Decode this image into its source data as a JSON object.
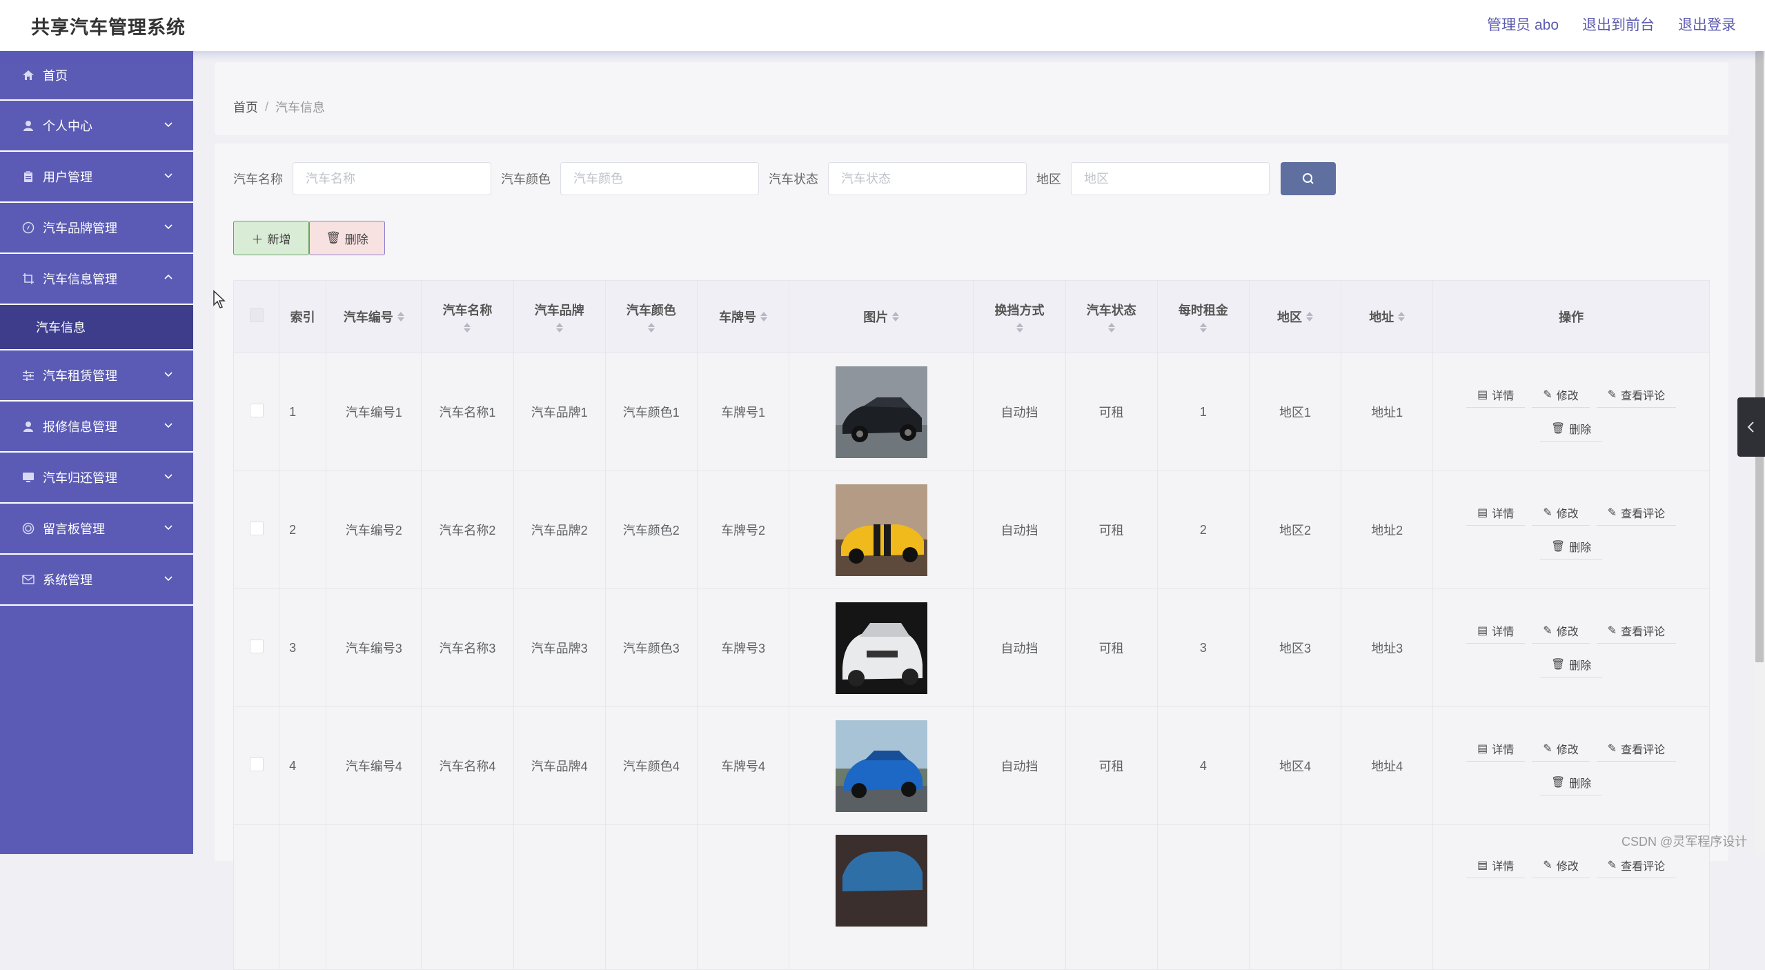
{
  "header": {
    "title": "共享汽车管理系统",
    "links": [
      "管理员 abo",
      "退出到前台",
      "退出登录"
    ]
  },
  "sidebar": {
    "items": [
      {
        "label": "首页",
        "icon": "home-icon"
      },
      {
        "label": "个人中心",
        "icon": "user-icon"
      },
      {
        "label": "用户管理",
        "icon": "clipboard-icon"
      },
      {
        "label": "汽车品牌管理",
        "icon": "compass-icon"
      },
      {
        "label": "汽车信息管理",
        "icon": "crop-icon"
      },
      {
        "label": "汽车租赁管理",
        "icon": "sliders-icon"
      },
      {
        "label": "报修信息管理",
        "icon": "user-icon"
      },
      {
        "label": "汽车归还管理",
        "icon": "monitor-icon"
      },
      {
        "label": "留言板管理",
        "icon": "target-icon"
      },
      {
        "label": "系统管理",
        "icon": "mail-icon"
      }
    ],
    "submenu": {
      "label": "汽车信息"
    }
  },
  "breadcrumb": {
    "home": "首页",
    "separator": "/",
    "current": "汽车信息"
  },
  "search": {
    "fields": [
      {
        "label": "汽车名称",
        "placeholder": "汽车名称"
      },
      {
        "label": "汽车颜色",
        "placeholder": "汽车颜色"
      },
      {
        "label": "汽车状态",
        "placeholder": "汽车状态"
      },
      {
        "label": "地区",
        "placeholder": "地区"
      }
    ]
  },
  "actions": {
    "add": "新增",
    "delete": "删除"
  },
  "table": {
    "headers": {
      "index": "索引",
      "car_no": "汽车编号",
      "car_name": "汽车名称",
      "brand": "汽车品牌",
      "color": "汽车颜色",
      "plate": "车牌号",
      "image": "图片",
      "transmission": "换挡方式",
      "status": "汽车状态",
      "rent": "每时租金",
      "region": "地区",
      "address": "地址",
      "ops": "操作"
    },
    "op_labels": {
      "detail": "详情",
      "edit": "修改",
      "comments": "查看评论",
      "delete": "删除"
    },
    "rows": [
      {
        "index": "1",
        "car_no": "汽车编号1",
        "car_name": "汽车名称1",
        "brand": "汽车品牌1",
        "color": "汽车颜色1",
        "plate": "车牌号1",
        "transmission": "自动挡",
        "status": "可租",
        "rent": "1",
        "region": "地区1",
        "address": "地址1"
      },
      {
        "index": "2",
        "car_no": "汽车编号2",
        "car_name": "汽车名称2",
        "brand": "汽车品牌2",
        "color": "汽车颜色2",
        "plate": "车牌号2",
        "transmission": "自动挡",
        "status": "可租",
        "rent": "2",
        "region": "地区2",
        "address": "地址2"
      },
      {
        "index": "3",
        "car_no": "汽车编号3",
        "car_name": "汽车名称3",
        "brand": "汽车品牌3",
        "color": "汽车颜色3",
        "plate": "车牌号3",
        "transmission": "自动挡",
        "status": "可租",
        "rent": "3",
        "region": "地区3",
        "address": "地址3"
      },
      {
        "index": "4",
        "car_no": "汽车编号4",
        "car_name": "汽车名称4",
        "brand": "汽车品牌4",
        "color": "汽车颜色4",
        "plate": "车牌号4",
        "transmission": "自动挡",
        "status": "可租",
        "rent": "4",
        "region": "地区4",
        "address": "地址4"
      }
    ],
    "partial_row": {
      "op_labels": [
        "详情",
        "修改",
        "查看评论"
      ]
    }
  },
  "colors": {
    "sidebar": "#5b5bb5",
    "submenu_active": "#3d3d8c",
    "search_button": "#5f6f9f",
    "accent_text": "#5a5ab0"
  },
  "watermark": "CSDN @灵军程序设计"
}
